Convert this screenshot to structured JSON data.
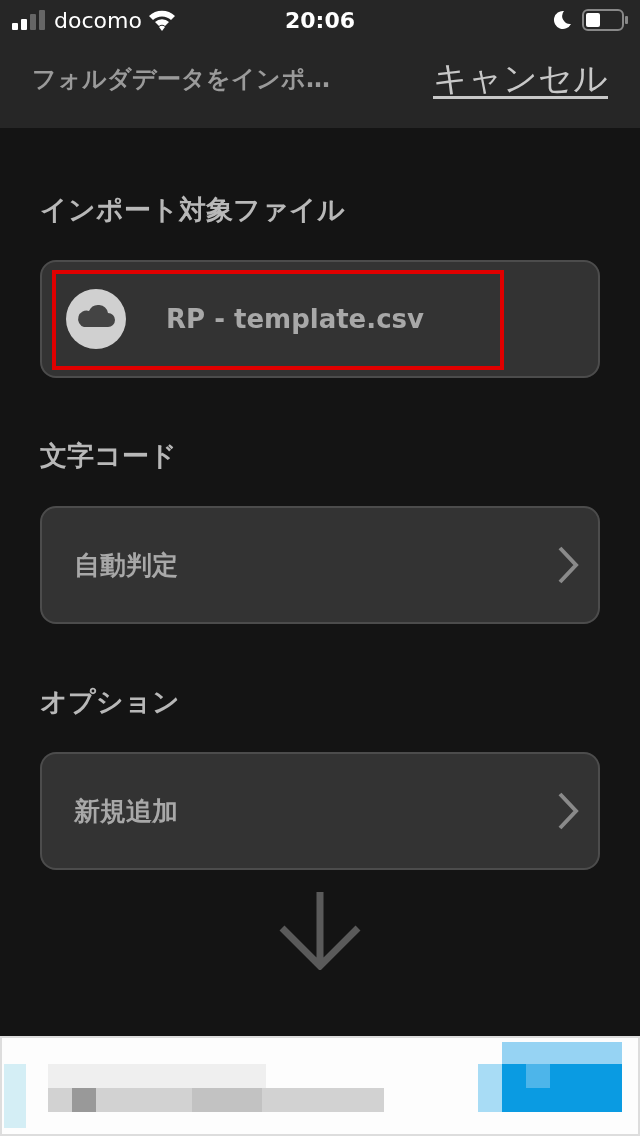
{
  "status_bar": {
    "carrier": "docomo",
    "time": "20:06"
  },
  "nav": {
    "title": "フォルダデータをインポ…",
    "cancel": "キャンセル"
  },
  "sections": [
    {
      "kind": "file",
      "label": "インポート対象ファイル",
      "value": "RP - template.csv",
      "highlighted": true
    },
    {
      "kind": "select",
      "label": "文字コード",
      "value": "自動判定"
    },
    {
      "kind": "select",
      "label": "オプション",
      "value": "新規追加"
    }
  ]
}
